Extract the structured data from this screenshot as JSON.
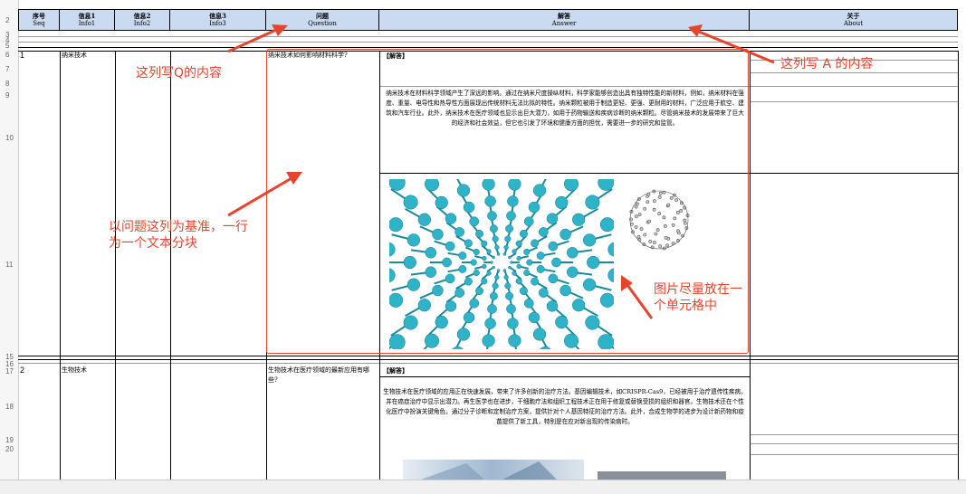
{
  "headers": [
    {
      "cn": "序号",
      "en": "Seq"
    },
    {
      "cn": "信息1",
      "en": "Info1"
    },
    {
      "cn": "信息2",
      "en": "Info2"
    },
    {
      "cn": "信息3",
      "en": "Info3"
    },
    {
      "cn": "问题",
      "en": "Question"
    },
    {
      "cn": "解答",
      "en": "Answer"
    },
    {
      "cn": "关于",
      "en": "About"
    }
  ],
  "row_numbers": [
    "2",
    "3",
    "4",
    "5",
    "6",
    "7",
    "8",
    "9",
    "10",
    "11",
    "15",
    "16",
    "17",
    "18",
    "19",
    "20"
  ],
  "rows": [
    {
      "seq": "1",
      "info1": "纳米技术",
      "question": "纳米技术如何影响材料科学?",
      "answer_title": "【解答】",
      "answer_text": "纳米技术在材料科学领域产生了深远的影响。通过在纳米尺度操纵材料，科学家能够创造出具有独特性能的新材料，例如，纳米材料在强度、重量、电导性和热导性方面展现出传统材料无法比拟的特性。纳米颗粒被用于制造更轻、更强、更耐用的材料，广泛应用于航空、建筑和汽车行业。此外，纳米技术在医疗领域也显示出巨大潜力，如用于药物输送和疾病诊断的纳米颗粒。尽管纳米技术的发展带来了巨大的经济和社会效益，但它也引发了环境和健康方面的担忧，需要进一步的研究和监管。"
    },
    {
      "seq": "2",
      "info1": "生物技术",
      "question": "生物技术在医疗领域的最新应用有哪些?",
      "answer_title": "【解答】",
      "answer_text": "生物技术在医疗领域的应用正在快速发展，带来了许多创新的治疗方法。基因编辑技术，如CRISPR-Cas9，已经被用于治疗遗传性疾病，并在癌症治疗中显示出潜力。再生医学也在进步，干细胞疗法和组织工程技术正在用于修复或替换受损的组织和器官。生物技术还在个性化医疗中扮演关键角色，通过分子诊断和定制治疗方案，提供针对个人基因特征的治疗方法。此外，合成生物学的进步为设计新药物和疫苗提供了新工具，特别是在应对新出现的传染病时。"
    }
  ],
  "annotations": {
    "q_col": "这列写Q的内容",
    "a_col": "这列写 A 的内容",
    "chunk": "以问题这列为基准，一行为一个文本分块",
    "image": "图片尽量放在一个单元格中"
  },
  "colors": {
    "accent": "#e8432c",
    "header_bg": "#c9daf1",
    "molecule": "#2fb3c9"
  }
}
